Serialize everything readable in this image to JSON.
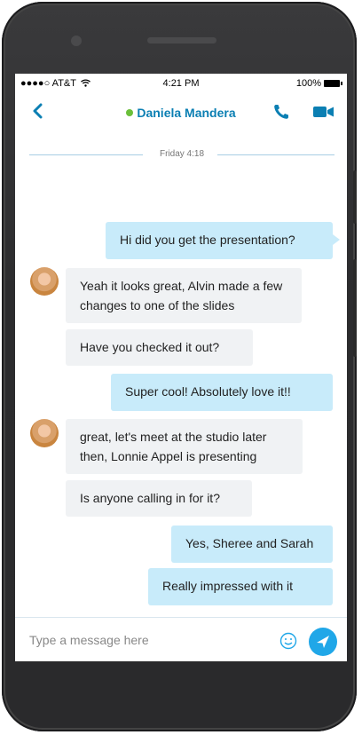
{
  "status_bar": {
    "carrier": "●●●●○ AT&T",
    "wifi_icon": "wifi-icon",
    "time": "4:21 PM",
    "battery": "100%"
  },
  "header": {
    "contact_name": "Daniela Mandera",
    "presence_color": "#6bbf3a",
    "accent_color": "#0b7fb3"
  },
  "conversation": {
    "date_divider": "Friday 4:18",
    "messages": [
      {
        "from": "me",
        "text": "Hi did you get the presentation?"
      },
      {
        "from": "them",
        "text": "Yeah it looks great, Alvin made a few changes to one of the slides"
      },
      {
        "from": "them",
        "text": "Have you checked it out?"
      },
      {
        "from": "me",
        "text": "Super cool! Absolutely love it!!"
      },
      {
        "from": "them",
        "text": "great, let's meet at the studio later then, Lonnie Appel is presenting"
      },
      {
        "from": "them",
        "text": "Is anyone calling in for it?"
      },
      {
        "from": "me",
        "text": "Yes, Sheree and Sarah"
      },
      {
        "from": "me",
        "text": "Really impressed with it"
      }
    ]
  },
  "composer": {
    "placeholder": "Type a message here",
    "send_color": "#20a7e8"
  }
}
